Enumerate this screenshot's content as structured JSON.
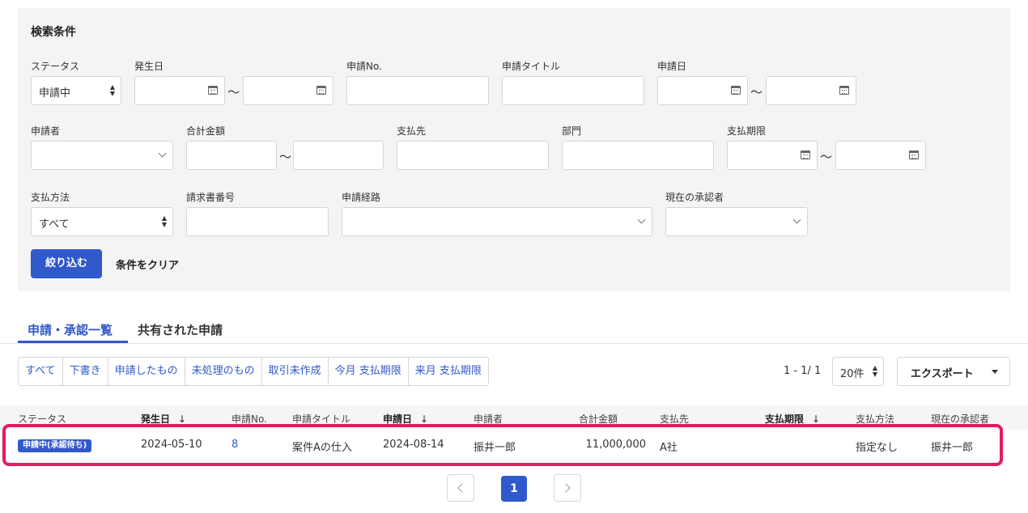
{
  "search": {
    "title": "検索条件",
    "status_label": "ステータス",
    "status_value": "申請中",
    "occurrence_date_label": "発生日",
    "application_no_label": "申請No.",
    "application_title_label": "申請タイトル",
    "application_date_label": "申請日",
    "applicant_label": "申請者",
    "total_amount_label": "合計金額",
    "payee_label": "支払先",
    "department_label": "部門",
    "payment_due_label": "支払期限",
    "payment_method_label": "支払方法",
    "payment_method_value": "すべて",
    "invoice_no_label": "請求書番号",
    "route_label": "申請経路",
    "current_approver_label": "現在の承認者",
    "range_separator": "〜",
    "filter_button": "絞り込む",
    "clear_button": "条件をクリア"
  },
  "tabs": [
    {
      "label": "申請・承認一覧",
      "active": true
    },
    {
      "label": "共有された申請",
      "active": false
    }
  ],
  "filters": [
    "すべて",
    "下書き",
    "申請したもの",
    "未処理のもの",
    "取引未作成",
    "今月 支払期限",
    "来月 支払期限"
  ],
  "pager": {
    "range_text": "1 - 1/ 1",
    "per_page": "20件",
    "export_label": "エクスポート",
    "current_page": "1"
  },
  "table": {
    "headers": {
      "status": "ステータス",
      "occurrence_date": "発生日",
      "application_no": "申請No.",
      "title": "申請タイトル",
      "application_date": "申請日",
      "applicant": "申請者",
      "total": "合計金額",
      "payee": "支払先",
      "due": "支払期限",
      "method": "支払方法",
      "approver": "現在の承認者"
    },
    "sort_arrow": "↓",
    "rows": [
      {
        "status": "申請中(承認待ち)",
        "occurrence_date": "2024-05-10",
        "application_no": "8",
        "title": "案件Aの仕入",
        "application_date": "2024-08-14",
        "applicant": "振井一郎",
        "total": "11,000,000",
        "payee": "A社",
        "due": "",
        "method": "指定なし",
        "approver": "振井一郎"
      }
    ]
  },
  "colors": {
    "accent": "#3059cc",
    "highlight": "#e8195e",
    "panel_bg": "#f4f4f4"
  }
}
